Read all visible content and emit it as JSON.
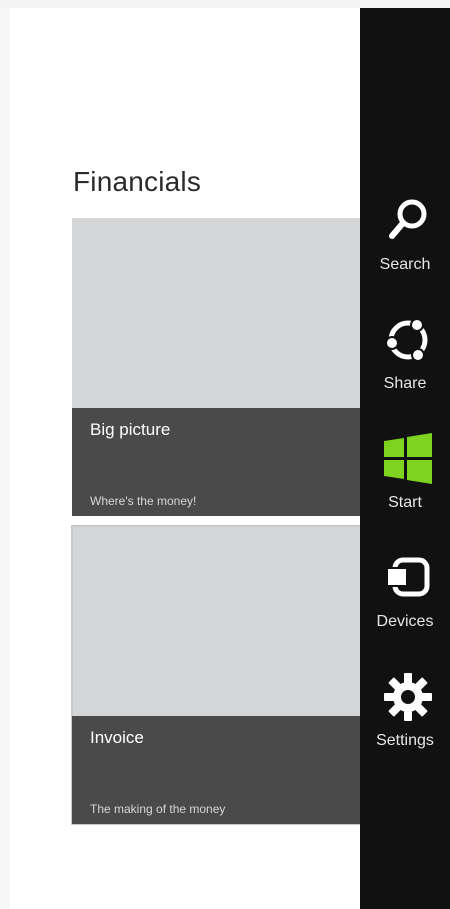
{
  "section": {
    "title": "Financials"
  },
  "tiles": [
    {
      "title": "Big picture",
      "subtitle": "Where's the money!"
    },
    {
      "title": "Invoice",
      "subtitle": "The making of the money"
    }
  ],
  "charms": [
    {
      "label": "Search",
      "icon": "search-icon"
    },
    {
      "label": "Share",
      "icon": "share-icon"
    },
    {
      "label": "Start",
      "icon": "windows-start-icon"
    },
    {
      "label": "Devices",
      "icon": "devices-icon"
    },
    {
      "label": "Settings",
      "icon": "settings-gear-icon"
    }
  ],
  "colors": {
    "charm_bar": "#111111",
    "start_logo": "#7ed321",
    "tile_face": "#d4d5d6",
    "tile_caption": "#4a4a4a"
  }
}
